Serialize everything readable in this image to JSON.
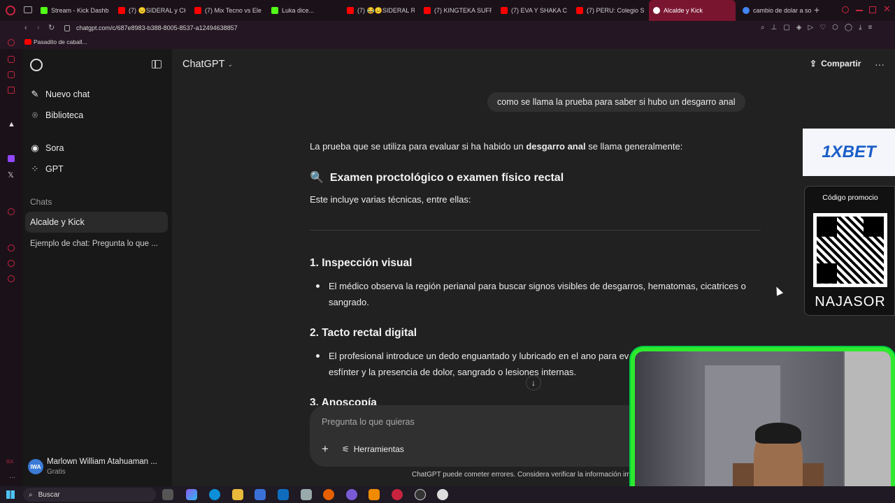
{
  "browser": {
    "tabs": [
      {
        "label": "Stream - Kick Dashb",
        "favicon": "kick-icon",
        "color": "#53fc18"
      },
      {
        "label": "(7) 😑SIDERAL y CH",
        "favicon": "youtube-icon",
        "color": "#ff0000"
      },
      {
        "label": "(7) Mix Tecno vs Ele",
        "favicon": "youtube-icon",
        "color": "#ff0000"
      },
      {
        "label": "Luka dice...",
        "favicon": "kick-icon",
        "color": "#53fc18"
      },
      {
        "label": "(7) 😂😑SIDERAL R",
        "favicon": "youtube-icon",
        "color": "#ff0000"
      },
      {
        "label": "(7) KINGTEKA SUFRI",
        "favicon": "youtube-icon",
        "color": "#ff0000"
      },
      {
        "label": "(7) EVA Y SHAKA C",
        "favicon": "youtube-icon",
        "color": "#ff0000"
      },
      {
        "label": "(7) PERU: Colegio Sr",
        "favicon": "youtube-icon",
        "color": "#ff0000"
      },
      {
        "label": "Alcalde y Kick",
        "favicon": "chatgpt-icon",
        "color": "#ffffff"
      },
      {
        "label": "cambio de dolar a so",
        "favicon": "google-icon",
        "color": "#4285f4"
      }
    ],
    "url": "chatgpt.com/c/687e8983-b388-8005-8537-a12494638857",
    "bookmark": "Pasadito de caball..."
  },
  "sidebar": {
    "new_chat": "Nuevo chat",
    "library": "Biblioteca",
    "sora": "Sora",
    "gpt": "GPT",
    "section_label": "Chats",
    "chats": [
      "Alcalde y Kick",
      "Ejemplo de chat: Pregunta lo que ..."
    ],
    "user_initials": "IWA",
    "user_name": "Marlown William Atahuaman ...",
    "user_plan": "Gratis"
  },
  "header": {
    "model": "ChatGPT",
    "share": "Compartir"
  },
  "conversation": {
    "user_message": "como se llama la prueba para saber si hubo un desgarro anal",
    "intro_pre": "La prueba que se utiliza para evaluar si ha habido un ",
    "intro_bold": "desgarro anal",
    "intro_post": " se llama generalmente:",
    "heading_emoji": "🔍",
    "heading": "Examen proctológico o examen físico rectal",
    "includes": "Este incluye varias técnicas, entre ellas:",
    "sections": [
      {
        "title": "1. Inspección visual",
        "line1": "El médico observa la región perianal para buscar signos visibles de desgarros, hematomas, cicatrices o",
        "line2": "sangrado."
      },
      {
        "title": "2. Tacto rectal digital",
        "line1": "El profesional introduce un dedo enguantado y lubricado en el ano para ev",
        "line2": "esfínter y la presencia de dolor, sangrado o lesiones internas."
      },
      {
        "title": "3. Anoscopía"
      }
    ]
  },
  "composer": {
    "placeholder": "Pregunta lo que quieras",
    "tools": "Herramientas",
    "disclaimer": "ChatGPT puede cometer errores. Considera verificar la información imp"
  },
  "ads": {
    "brand": "1XBET",
    "promo_label": "Código promocio",
    "promo_code": "NAJASOR"
  },
  "taskbar": {
    "search": "Buscar"
  }
}
